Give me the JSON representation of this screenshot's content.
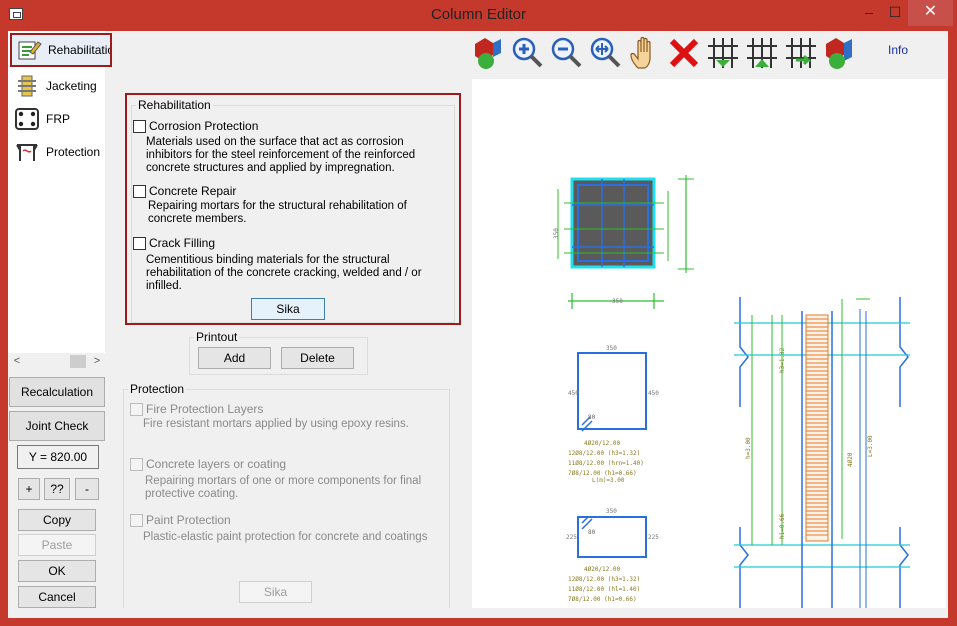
{
  "window": {
    "title": "Column Editor",
    "min_glyph": "–",
    "max_glyph": "☐",
    "close_glyph": "✕"
  },
  "sidebar": {
    "items": [
      {
        "label": "Rehabilitation",
        "icon": "rehabilitation-icon",
        "selected": true
      },
      {
        "label": "Jacketing",
        "icon": "jacketing-icon"
      },
      {
        "label": "FRP",
        "icon": "frp-icon"
      },
      {
        "label": "Protection",
        "icon": "protection-icon"
      }
    ],
    "scroll_left": "<",
    "scroll_right": ">"
  },
  "left_buttons": {
    "recalculation": "Recalculation",
    "joint_check": "Joint Check",
    "y_value": "Y = 820.00",
    "plus": "+",
    "question": "??",
    "minus": "-",
    "copy": "Copy",
    "paste": "Paste",
    "ok": "OK",
    "cancel": "Cancel"
  },
  "rehabilitation": {
    "group_title": "Rehabilitation",
    "options": [
      {
        "label": "Corrosion Protection",
        "description": [
          "Materials used on the surface that act as corrosion",
          "inhibitors for the steel reinforcement of the reinforced",
          "concrete structures and applied by impregnation."
        ],
        "checked": false
      },
      {
        "label": "Concrete Repair",
        "description": [
          "Repairing mortars for the structural rehabilitation of",
          "concrete members."
        ],
        "checked": false
      },
      {
        "label": "Crack Filling",
        "description": [
          "Cementitious binding materials for the structural",
          "rehabilitation of the concrete cracking, welded and / or",
          "infilled."
        ],
        "checked": false
      }
    ],
    "sika_button": "Sika"
  },
  "printout": {
    "group_title": "Printout",
    "add": "Add",
    "delete": "Delete"
  },
  "protection": {
    "group_title": "Protection",
    "options": [
      {
        "label": "Fire Protection Layers",
        "description": [
          "Fire resistant mortars applied by using epoxy resins."
        ]
      },
      {
        "label": "Concrete layers or coating",
        "description": [
          "Repairing mortars of one or more components for final",
          "protective coating."
        ]
      },
      {
        "label": "Paint Protection",
        "description": [
          "Plastic-elastic paint protection for concrete and coatings"
        ]
      }
    ],
    "sika_button": "Sika"
  },
  "toolbar": {
    "tools": [
      "3d-view-icon",
      "zoom-in-icon",
      "zoom-out-icon",
      "zoom-window-icon",
      "pan-hand-icon",
      "delete-icon",
      "stirrup-edit-icon",
      "stirrup-up-icon",
      "stirrup-next-icon",
      "3d-render-icon"
    ],
    "info": "Info"
  },
  "drawing": {
    "section1": {
      "top": "350",
      "side": "350"
    },
    "section2": {
      "top": "350",
      "left": "450",
      "right": "450",
      "corner": "80",
      "notes": [
        "4Ø20/12.00",
        "12Ø8/12.00 (h3=1.32)",
        "11Ø8/12.00 (hrn=1.40)",
        "7Ø8/12.00 (h1=0.66)",
        "L(m)=3.00"
      ]
    },
    "section3": {
      "top": "350",
      "left": "225",
      "right": "225",
      "corner": "80",
      "notes": [
        "4Ø20/12.00",
        "12Ø8/12.00 (h3=1.32)",
        "11Ø8/12.00 (hl=1.40)",
        "7Ø8/12.00 (h1=0.66)",
        "L(m)=3.00"
      ]
    },
    "elevation": {
      "dims": [
        "h3=1.32",
        "h=3.00",
        "h1=0.66"
      ],
      "label_left": "4Ø20",
      "label_right": "L=3.00"
    }
  }
}
